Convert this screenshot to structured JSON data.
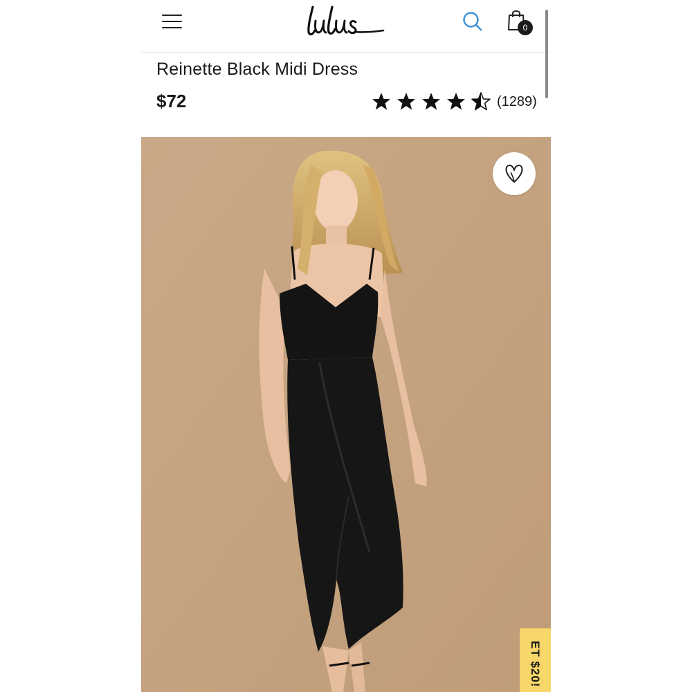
{
  "header": {
    "brand": "Lulus",
    "cart_count": "0"
  },
  "product": {
    "title": "Reinette Black Midi Dress",
    "price": "$72",
    "rating": {
      "stars": 4.5,
      "max_stars": 5,
      "review_count": "(1289)"
    }
  },
  "image": {
    "description_icon": "product-photo",
    "background_color": "#c6a582"
  },
  "promo": {
    "label": "ET $20!",
    "color": "#f7d66a"
  },
  "icons": {
    "menu": "hamburger-menu-icon",
    "search": "search-icon",
    "cart": "shopping-bag-icon",
    "favorite": "heart-icon",
    "star": "star-icon"
  },
  "colors": {
    "search_accent": "#3b8fd6",
    "text": "#1a1a1a"
  }
}
